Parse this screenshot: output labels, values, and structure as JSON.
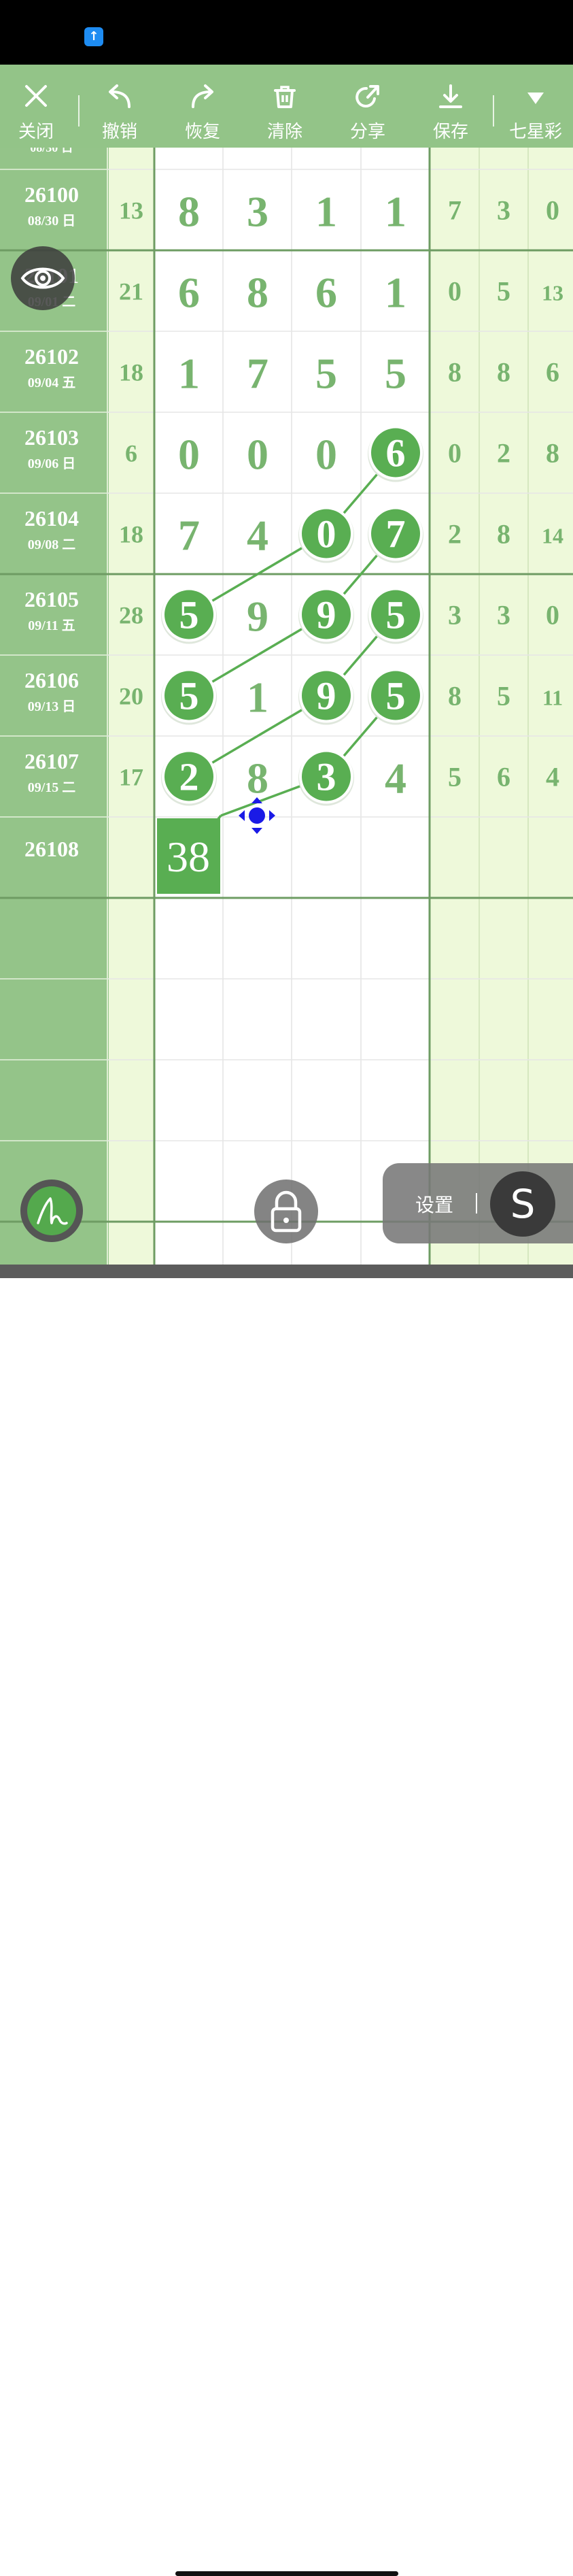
{
  "toolbar": {
    "close": "关闭",
    "undo": "撤销",
    "redo": "恢复",
    "clear": "清除",
    "share": "分享",
    "save": "保存",
    "lottery": "七星彩"
  },
  "rows": [
    {
      "issue": "26100",
      "date": "08/30 日",
      "sum": "13",
      "digits": [
        "8",
        "3",
        "1",
        "1"
      ],
      "tail": [
        "7",
        "3",
        "0"
      ]
    },
    {
      "issue": "26101",
      "date": "09/01 二",
      "sum": "21",
      "digits": [
        "6",
        "8",
        "6",
        "1"
      ],
      "tail": [
        "0",
        "5",
        "13"
      ]
    },
    {
      "issue": "26102",
      "date": "09/04 五",
      "sum": "18",
      "digits": [
        "1",
        "7",
        "5",
        "5"
      ],
      "tail": [
        "8",
        "8",
        "6"
      ]
    },
    {
      "issue": "26103",
      "date": "09/06 日",
      "sum": "6",
      "digits": [
        "0",
        "0",
        "0",
        "6"
      ],
      "tail": [
        "0",
        "2",
        "8"
      ]
    },
    {
      "issue": "26104",
      "date": "09/08 二",
      "sum": "18",
      "digits": [
        "7",
        "4",
        "0",
        "7"
      ],
      "tail": [
        "2",
        "8",
        "14"
      ]
    },
    {
      "issue": "26105",
      "date": "09/11 五",
      "sum": "28",
      "digits": [
        "5",
        "9",
        "9",
        "5"
      ],
      "tail": [
        "3",
        "3",
        "0"
      ]
    },
    {
      "issue": "26106",
      "date": "09/13 日",
      "sum": "20",
      "digits": [
        "5",
        "1",
        "9",
        "5"
      ],
      "tail": [
        "8",
        "5",
        "11"
      ]
    },
    {
      "issue": "26107",
      "date": "09/15 二",
      "sum": "17",
      "digits": [
        "2",
        "8",
        "3",
        "4"
      ],
      "tail": [
        "5",
        "6",
        "4"
      ]
    },
    {
      "issue": "26108",
      "date": "",
      "sum": "",
      "digits": [
        "",
        "",
        "",
        ""
      ],
      "tail": [
        "",
        "",
        ""
      ]
    }
  ],
  "prediction": "38",
  "settings": {
    "label": "设置",
    "button": "S"
  },
  "colors": {
    "green_dark": "#94c489",
    "green_light": "#eef9da",
    "ball": "#59ae52",
    "digit": "#78b46f",
    "grid_line": "#6e9c63",
    "handle": "#1a1ae6"
  }
}
